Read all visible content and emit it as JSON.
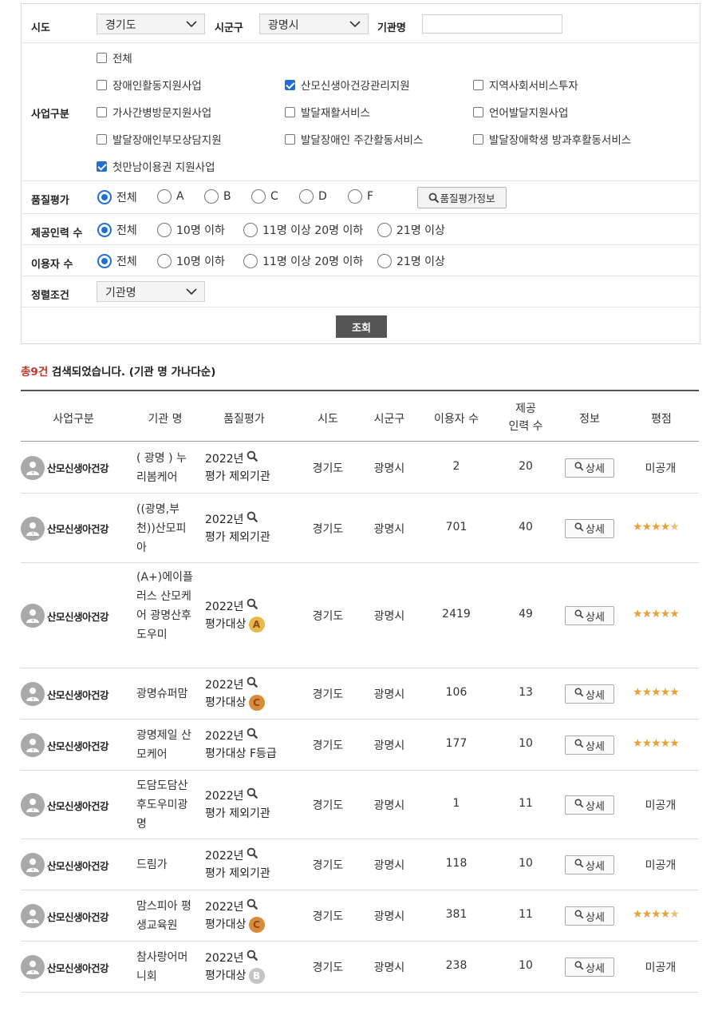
{
  "filters": {
    "sido_label": "시도",
    "sido_value": "경기도",
    "sigungu_label": "시군구",
    "sigungu_value": "광명시",
    "org_label": "기관명",
    "org_value": "",
    "biz_label": "사업구분",
    "biz_options": [
      {
        "label": "전체",
        "checked": false
      },
      {
        "label": "장애인활동지원사업",
        "checked": false
      },
      {
        "label": "산모신생아건강관리지원",
        "checked": true
      },
      {
        "label": "지역사회서비스투자",
        "checked": false
      },
      {
        "label": "가사간병방문지원사업",
        "checked": false
      },
      {
        "label": "발달재활서비스",
        "checked": false
      },
      {
        "label": "언어발달지원사업",
        "checked": false
      },
      {
        "label": "발달장애인부모상담지원",
        "checked": false
      },
      {
        "label": "발달장애인 주간활동서비스",
        "checked": false
      },
      {
        "label": "발달장애학생 방과후활동서비스",
        "checked": false
      },
      {
        "label": "첫만남이용권 지원사업",
        "checked": true
      }
    ],
    "quality_label": "품질평가",
    "quality_options": [
      "전체",
      "A",
      "B",
      "C",
      "D",
      "F"
    ],
    "quality_info_button": "품질평가정보",
    "staff_label": "제공인력 수",
    "staff_options": [
      "전체",
      "10명 이하",
      "11명 이상 20명 이하",
      "21명 이상"
    ],
    "users_label": "이용자 수",
    "users_options": [
      "전체",
      "10명 이하",
      "11명 이상 20명 이하",
      "21명 이상"
    ],
    "sort_label": "정렬조건",
    "sort_value": "기관명",
    "search_button": "조회"
  },
  "summary": {
    "count": "총9건",
    "text": " 검색되었습니다. (기관 명 가나다순)"
  },
  "table": {
    "headers": {
      "category": "사업구분",
      "org": "기관 명",
      "quality": "품질평가",
      "sido": "시도",
      "sigungu": "시군구",
      "users": "이용자 수",
      "staff": "제공\n인력 수",
      "info": "정보",
      "score": "평점"
    },
    "detail_label": "상세",
    "rows": [
      {
        "category": "산모신생아건강",
        "org": "( 광명 ) 누리봄케어",
        "year": "2022년",
        "quality": "평가 제외기관",
        "grade": "",
        "sido": "경기도",
        "sigungu": "광명시",
        "users": "2",
        "staff": "20",
        "score_text": "미공개",
        "stars": 0
      },
      {
        "category": "산모신생아건강",
        "org": "((광명,부천))산모피아",
        "year": "2022년",
        "quality": "평가 제외기관",
        "grade": "",
        "sido": "경기도",
        "sigungu": "광명시",
        "users": "701",
        "staff": "40",
        "score_text": "",
        "stars": 4.5
      },
      {
        "category": "산모신생아건강",
        "org": "(A+)에이플러스 산모케어 광명산후도우미",
        "year": "2022년",
        "quality": "평가대상",
        "grade": "A",
        "sido": "경기도",
        "sigungu": "광명시",
        "users": "2419",
        "staff": "49",
        "score_text": "",
        "stars": 5
      },
      {
        "category": "산모신생아건강",
        "org": "광명슈퍼맘",
        "year": "2022년",
        "quality": "평가대상",
        "grade": "C",
        "sido": "경기도",
        "sigungu": "광명시",
        "users": "106",
        "staff": "13",
        "score_text": "",
        "stars": 5
      },
      {
        "category": "산모신생아건강",
        "org": "광명제일 산모케어",
        "year": "2022년",
        "quality": "평가대상 F등급",
        "grade": "",
        "sido": "경기도",
        "sigungu": "광명시",
        "users": "177",
        "staff": "10",
        "score_text": "",
        "stars": 5
      },
      {
        "category": "산모신생아건강",
        "org": "도담도담산후도우미광명",
        "year": "2022년",
        "quality": "평가 제외기관",
        "grade": "",
        "sido": "경기도",
        "sigungu": "광명시",
        "users": "1",
        "staff": "11",
        "score_text": "미공개",
        "stars": 0
      },
      {
        "category": "산모신생아건강",
        "org": "드림가",
        "year": "2022년",
        "quality": "평가 제외기관",
        "grade": "",
        "sido": "경기도",
        "sigungu": "광명시",
        "users": "118",
        "staff": "10",
        "score_text": "미공개",
        "stars": 0
      },
      {
        "category": "산모신생아건강",
        "org": "맘스피아 평생교육원",
        "year": "2022년",
        "quality": "평가대상",
        "grade": "C",
        "sido": "경기도",
        "sigungu": "광명시",
        "users": "381",
        "staff": "11",
        "score_text": "",
        "stars": 4.5
      },
      {
        "category": "산모신생아건강",
        "org": "참사랑어머니회",
        "year": "2022년",
        "quality": "평가대상",
        "grade": "B",
        "sido": "경기도",
        "sigungu": "광명시",
        "users": "238",
        "staff": "10",
        "score_text": "미공개",
        "stars": 0
      }
    ]
  },
  "colors": {
    "accent": "#1f6fd6",
    "count_red": "#c0392b",
    "star": "#e8a23a",
    "grade_A": "#e8b84a",
    "grade_B": "#c4c4c4",
    "grade_C": "#d98a3a"
  }
}
